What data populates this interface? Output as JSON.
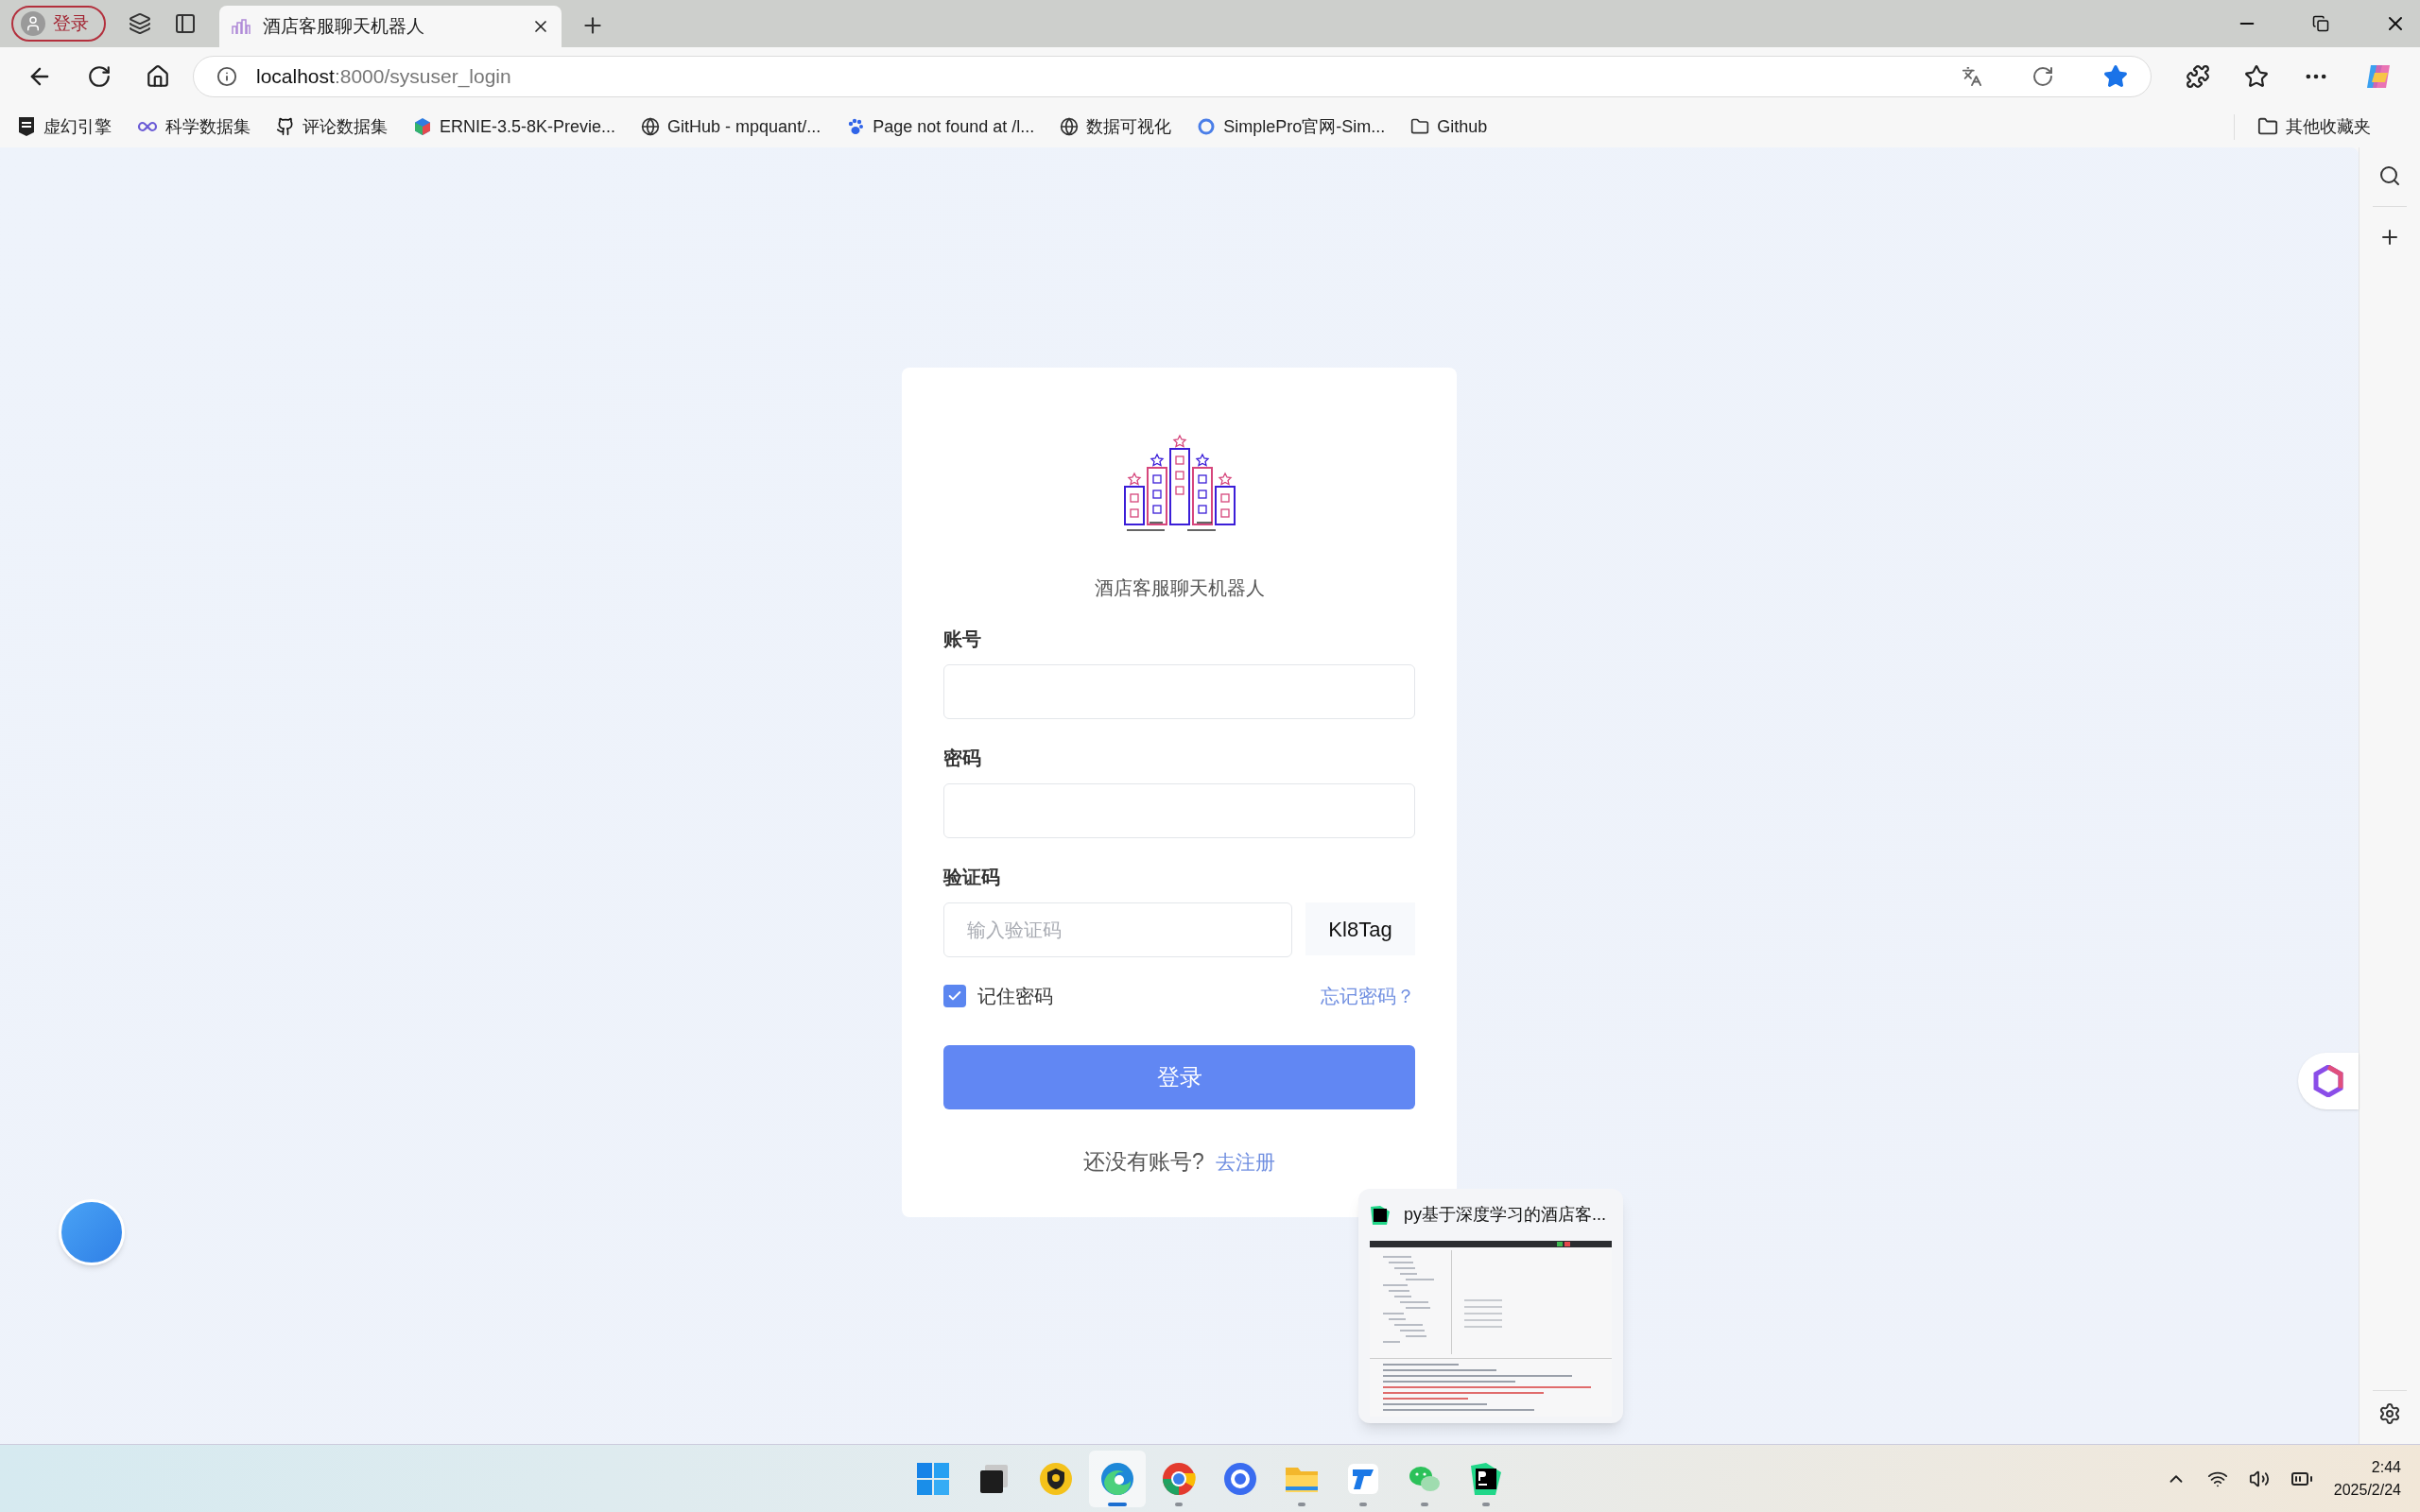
{
  "browser": {
    "profile_button": "登录",
    "tab": {
      "title": "酒店客服聊天机器人",
      "selected": true
    },
    "address": {
      "host": "localhost",
      "path": ":8000/sysuser_login"
    },
    "bookmarks": [
      {
        "label": "虚幻引擎",
        "kind": "epic"
      },
      {
        "label": "科学数据集",
        "kind": "infinity"
      },
      {
        "label": "评论数据集",
        "kind": "github"
      },
      {
        "label": "ERNIE-3.5-8K-Previe...",
        "kind": "cube"
      },
      {
        "label": "GitHub - mpquant/...",
        "kind": "globe"
      },
      {
        "label": "Page not found at /l...",
        "kind": "paw"
      },
      {
        "label": "数据可视化",
        "kind": "globe"
      },
      {
        "label": "SimplePro官网-Sim...",
        "kind": "ring"
      },
      {
        "label": "Github",
        "kind": "folder"
      }
    ],
    "other_bookmarks": "其他收藏夹"
  },
  "login": {
    "title": "酒店客服聊天机器人",
    "fields": [
      {
        "label": "账号",
        "kind": "text"
      },
      {
        "label": "密码",
        "kind": "password"
      },
      {
        "label": "验证码",
        "kind": "captcha",
        "placeholder": "输入验证码",
        "code": "Kl8Tag"
      }
    ],
    "remember": {
      "label": "记住密码",
      "checked": true
    },
    "forgot": "忘记密码？",
    "submit": "登录",
    "register_prompt": "还没有账号?",
    "register_link": "去注册"
  },
  "preview": {
    "title": "py基于深度学习的酒店客..."
  },
  "taskbar": {
    "apps": [
      {
        "kind": "start",
        "running": false,
        "selected": false
      },
      {
        "kind": "taskview",
        "running": false,
        "selected": false
      },
      {
        "kind": "shield",
        "running": false,
        "selected": false
      },
      {
        "kind": "edge",
        "running": true,
        "selected": true
      },
      {
        "kind": "chrome",
        "running": true,
        "selected": false
      },
      {
        "kind": "bluering",
        "running": false,
        "selected": false
      },
      {
        "kind": "folder",
        "running": true,
        "selected": false
      },
      {
        "kind": "bluet",
        "running": true,
        "selected": false
      },
      {
        "kind": "wechat",
        "running": true,
        "selected": false
      },
      {
        "kind": "pycharm",
        "running": true,
        "selected": false
      }
    ],
    "time": "2:44",
    "date": "2025/2/24"
  }
}
